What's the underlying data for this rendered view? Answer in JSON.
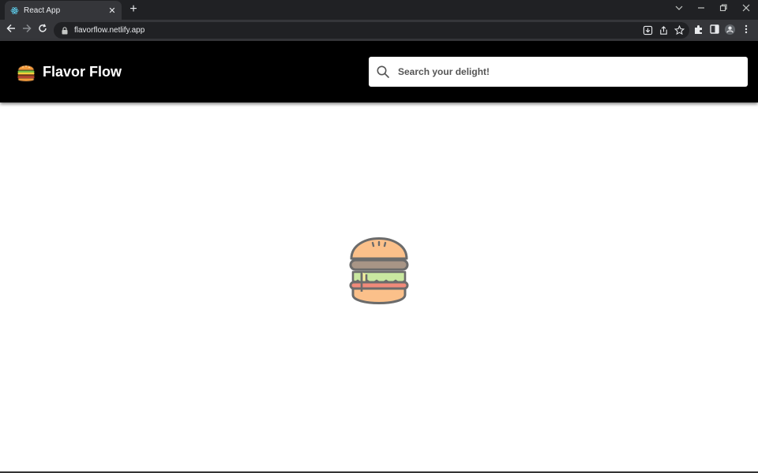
{
  "browser": {
    "tab": {
      "title": "React App",
      "favicon": "react-icon"
    },
    "new_tab_label": "+",
    "url": "flavorflow.netlify.app"
  },
  "header": {
    "brand": "Flavor Flow",
    "logo_icon": "burger-icon",
    "background": "#000000"
  },
  "search": {
    "placeholder": "Search your delight!"
  },
  "main": {
    "loader_icon": "burger-icon"
  }
}
